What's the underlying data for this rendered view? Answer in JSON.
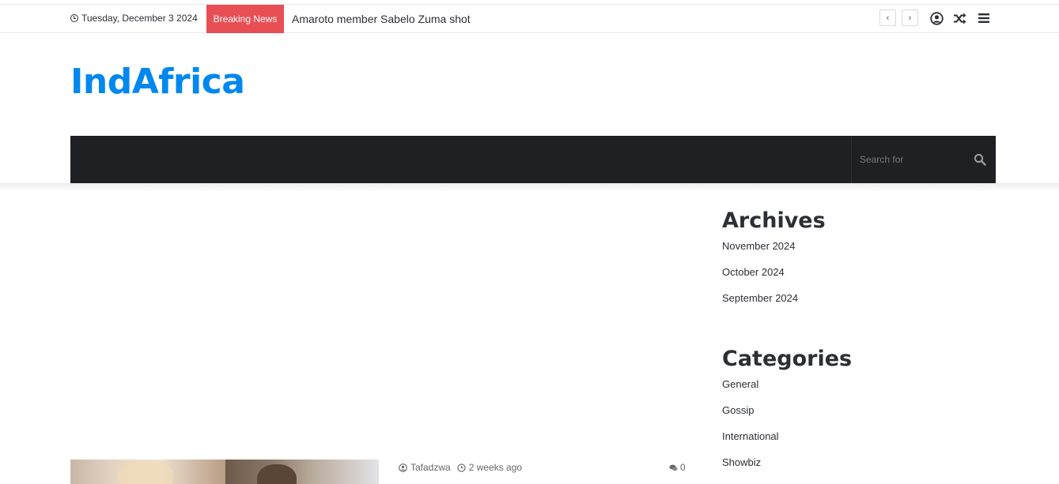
{
  "topbar": {
    "date": "Tuesday, December 3 2024",
    "breaking_label": "Breaking News",
    "ticker_text": "Amaroto member Sabelo Zuma shot",
    "prev_glyph": "‹",
    "next_glyph": "›",
    "icons": [
      "clock-icon",
      "chevron-left-icon",
      "chevron-right-icon",
      "user-icon",
      "shuffle-icon",
      "menu-icon"
    ]
  },
  "header": {
    "logo_text": "IndAfrica",
    "logo_color": "#0088ee"
  },
  "nav": {
    "background": "#1f2024",
    "search_placeholder": "Search for",
    "search_icon": "search-icon"
  },
  "sidebar": {
    "archives_title": "Archives",
    "archives": [
      "November 2024",
      "October 2024",
      "September 2024"
    ],
    "categories_title": "Categories",
    "categories": [
      "General",
      "Gossip",
      "International",
      "Showbiz"
    ]
  },
  "post": {
    "author": "Tafadzwa",
    "time_ago": "2 weeks ago",
    "comments": "0"
  },
  "colors": {
    "breaking_bg": "#e74f55",
    "text": "#2c2f34"
  }
}
